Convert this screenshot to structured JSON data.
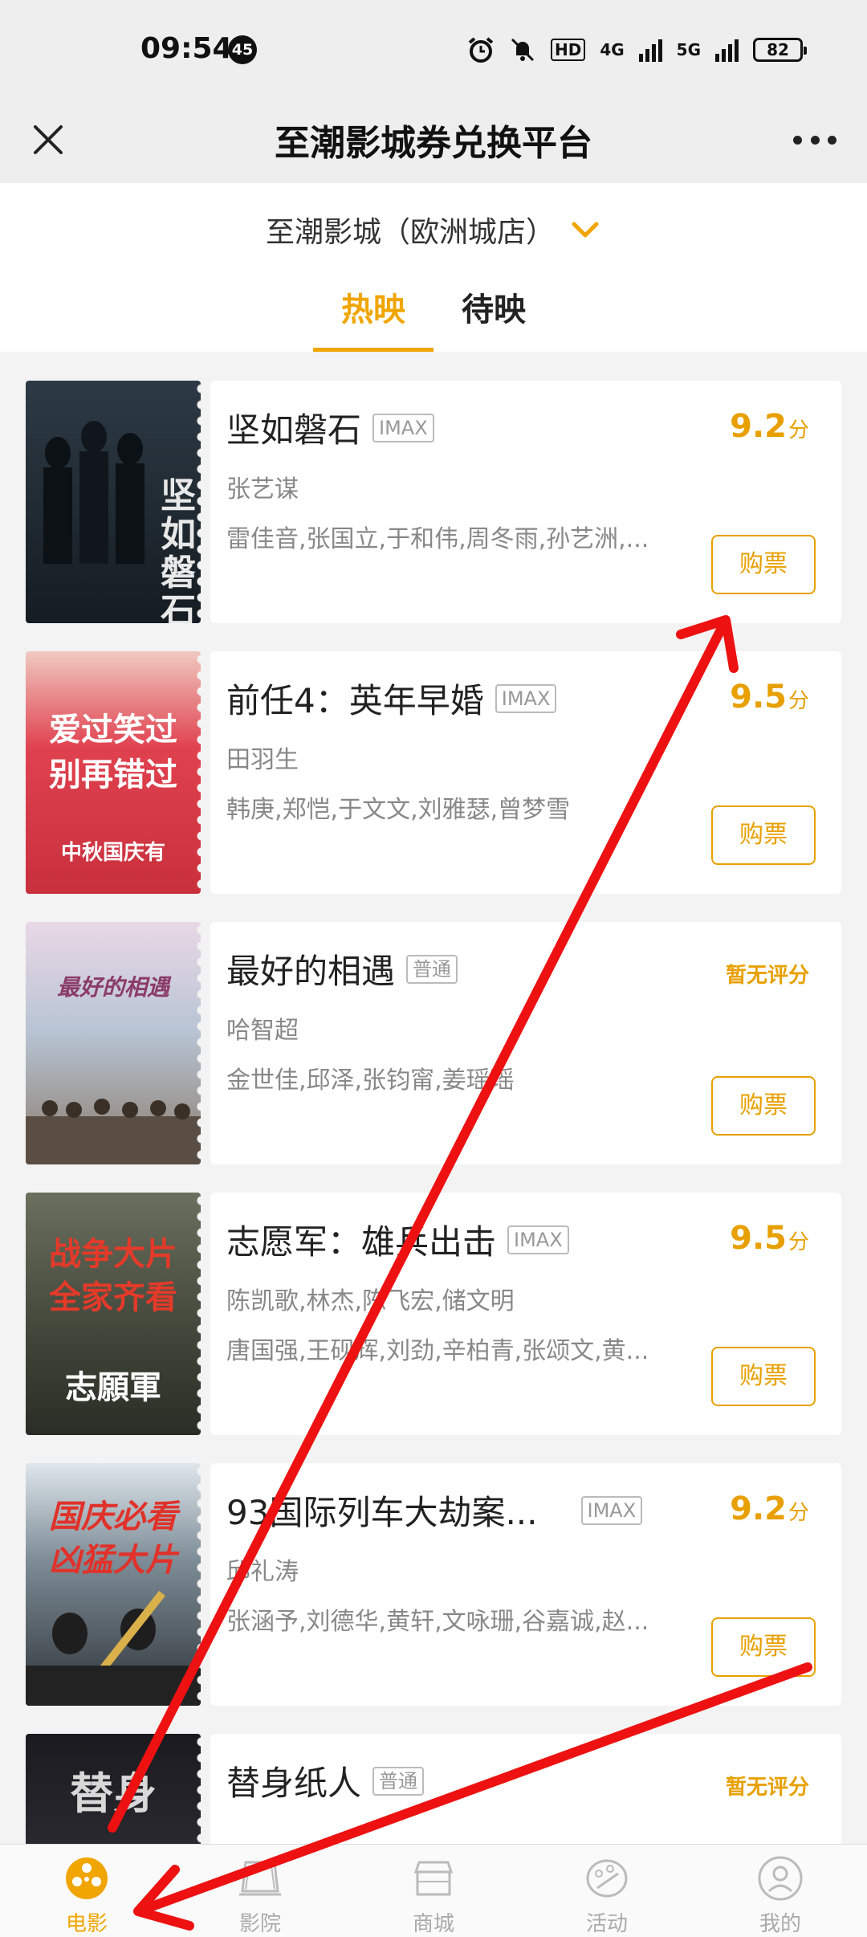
{
  "status_bar": {
    "time": "09:54",
    "notification_count": "45",
    "network_1": "4G",
    "network_2": "5G",
    "hd_label": "HD",
    "battery": "82"
  },
  "header": {
    "title": "至潮影城券兑换平台"
  },
  "cinema": {
    "name": "至潮影城（欧洲城店）"
  },
  "tabs": [
    {
      "label": "热映",
      "active": true
    },
    {
      "label": "待映",
      "active": false
    }
  ],
  "movies": [
    {
      "title": "坚如磐石",
      "format": "IMAX",
      "director": "张艺谋",
      "cast": "雷佳音,张国立,于和伟,周冬雨,孙艺洲,...",
      "score": "9.2",
      "score_unit": "分",
      "buy_label": "购票",
      "poster_text": "坚如磐石",
      "poster_color": "#1e2a33"
    },
    {
      "title": "前任4：英年早婚",
      "format": "IMAX",
      "director": "田羽生",
      "cast": "韩庚,郑恺,于文文,刘雅瑟,曾梦雪",
      "score": "9.5",
      "score_unit": "分",
      "buy_label": "购票",
      "poster_text": "爱过笑过 别再错过",
      "poster_sub": "中秋国庆有",
      "poster_color": "#d9434c"
    },
    {
      "title": "最好的相遇",
      "format": "普通",
      "director": "哈智超",
      "cast": "金世佳,邱泽,张钧甯,姜瑶瑶",
      "score_text": "暂无评分",
      "buy_label": "购票",
      "poster_text": "最好的相遇",
      "poster_color": "#c7b4c4"
    },
    {
      "title": "志愿军：雄兵出击",
      "format": "IMAX",
      "director": "陈凯歌,林杰,陈飞宏,储文明",
      "cast": "唐国强,王砚辉,刘劲,辛柏青,张颂文,黄...",
      "score": "9.5",
      "score_unit": "分",
      "buy_label": "购票",
      "poster_text": "战争大片 全家齐看",
      "poster_sub": "志願軍",
      "poster_color": "#4b5548"
    },
    {
      "title": "93国际列车大劫案...",
      "format": "IMAX",
      "director": "邱礼涛",
      "cast": "张涵予,刘德华,黄轩,文咏珊,谷嘉诚,赵...",
      "score": "9.2",
      "score_unit": "分",
      "buy_label": "购票",
      "poster_text": "国庆必看 凶猛大片",
      "poster_color": "#6b7a86"
    },
    {
      "title": "替身纸人",
      "format": "普通",
      "director": "",
      "cast": "",
      "score_text": "暂无评分",
      "buy_label": "",
      "poster_text": "替身",
      "poster_color": "#2a2a30"
    }
  ],
  "bottom_nav": [
    {
      "label": "电影",
      "icon": "film-reel-icon",
      "active": true
    },
    {
      "label": "影院",
      "icon": "cinema-icon",
      "active": false
    },
    {
      "label": "商城",
      "icon": "store-icon",
      "active": false
    },
    {
      "label": "活动",
      "icon": "activity-icon",
      "active": false
    },
    {
      "label": "我的",
      "icon": "profile-icon",
      "active": false
    }
  ],
  "colors": {
    "accent": "#f0a500",
    "annotation_arrow": "#ee1111"
  }
}
